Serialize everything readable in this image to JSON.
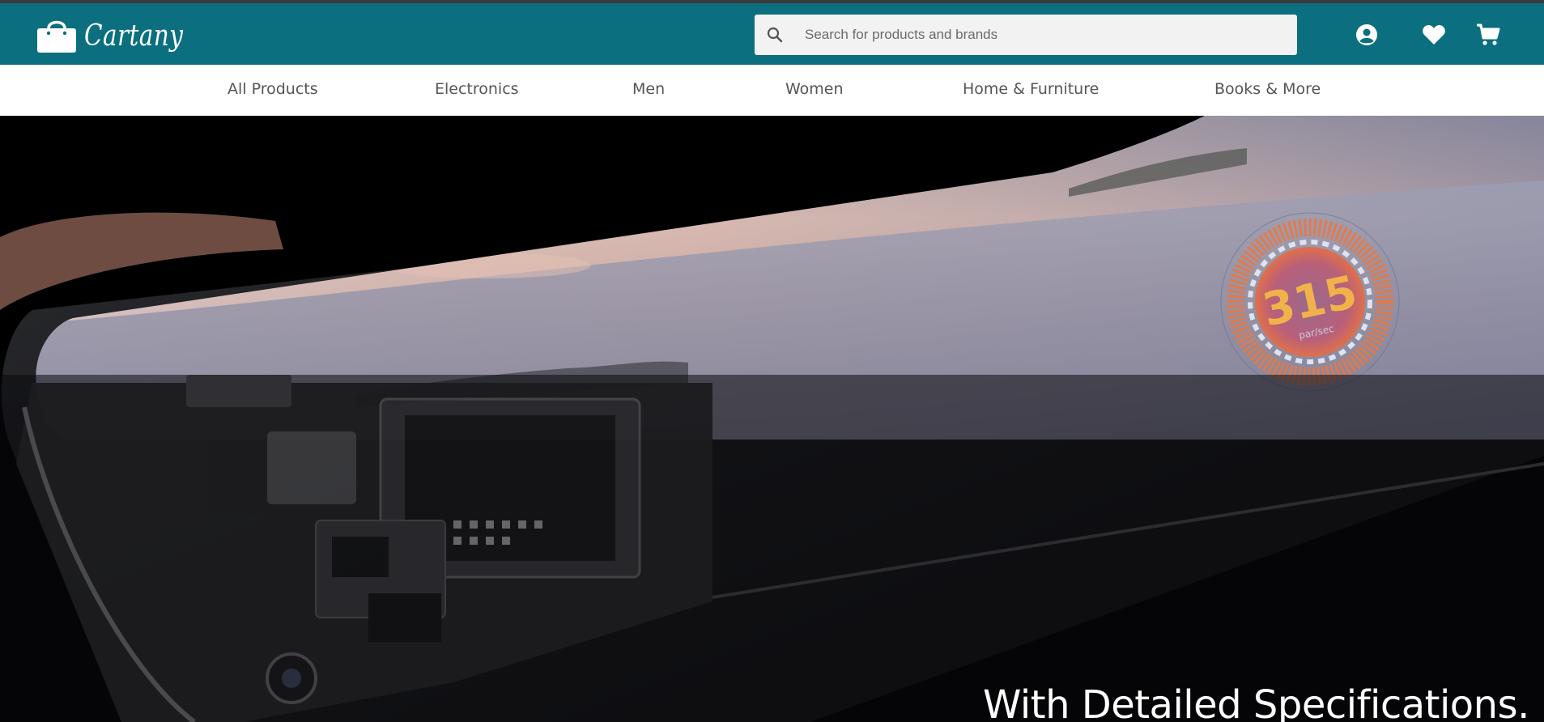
{
  "header": {
    "brand": "Cartany",
    "search": {
      "placeholder": "Search for products and brands",
      "value": ""
    },
    "icons": [
      "account-icon",
      "wishlist-heart-icon",
      "cart-icon"
    ],
    "colors": {
      "header_bg": "#0b6f7f",
      "search_bg": "#f2f2f2"
    }
  },
  "nav": {
    "items": [
      {
        "label": "All Products"
      },
      {
        "label": "Electronics"
      },
      {
        "label": "Men"
      },
      {
        "label": "Women"
      },
      {
        "label": "Home & Furniture"
      },
      {
        "label": "Books & More"
      }
    ]
  },
  "hero": {
    "headline": "With Detailed Specifications.",
    "gauge_value": "315",
    "gauge_unit": "par/sec"
  }
}
